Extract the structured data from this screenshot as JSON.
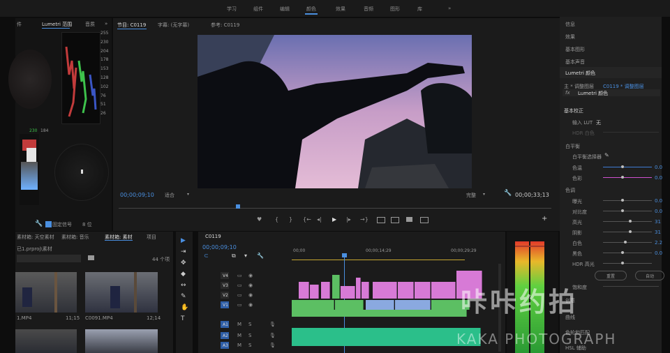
{
  "menu": [
    "学习",
    "组件",
    "编辑",
    "颜色",
    "效果",
    "音频",
    "图形",
    "库",
    "»"
  ],
  "scope": {
    "tab_prev": "件",
    "tab_active": "Lumetri 范围",
    "tab_next": "音质",
    "more": "»",
    "waveform_scale": [
      "255",
      "230",
      "204",
      "178",
      "153",
      "128",
      "102",
      "76",
      "51",
      "26"
    ],
    "hist_scale": [
      "230",
      "184"
    ],
    "bit_depth_label": "固定信号",
    "bit_value": "8 位"
  },
  "program": {
    "tab_program": "节目: C0119",
    "tab_caption": "字幕: (无字幕)",
    "tab_ref": "参考: C0119",
    "timecode": "00;00;09;10",
    "fit": "适合",
    "quality": "完整",
    "duration": "00;00;33;13",
    "transport_left": [
      "♥",
      "{",
      "}"
    ],
    "transport_main": [
      "{←",
      "◂|",
      "▶",
      "|▸",
      "→}"
    ]
  },
  "right": {
    "items": [
      "信息",
      "效果",
      "基本图形",
      "基本声音"
    ],
    "lumetri_title": "Lumetri 颜色",
    "path_main": "主 * 调整图层",
    "path_clip": "C0119 * 调整图层",
    "fx": "fx",
    "effect_name": "Lumetri 颜色",
    "basic": "基本校正",
    "lut_label": "输入 LUT",
    "lut_value": "无",
    "hdr_label": "HDR 白色",
    "wb_group": "白平衡",
    "wb_picker": "白平衡选择器",
    "wb_sliders": [
      {
        "label": "色温",
        "value": "0.0",
        "pos": 0.4,
        "color": "#3f7dd6"
      },
      {
        "label": "色彩",
        "value": "0.0",
        "pos": 0.4,
        "color": "#d050d0"
      }
    ],
    "tone_group": "色调",
    "tone_sliders": [
      {
        "label": "曝光",
        "value": "0.0",
        "pos": 0.4
      },
      {
        "label": "对比度",
        "value": "0.0",
        "pos": 0.4
      },
      {
        "label": "高光",
        "value": "31",
        "pos": 0.55
      },
      {
        "label": "阴影",
        "value": "31",
        "pos": 0.55
      },
      {
        "label": "白色",
        "value": "2.2",
        "pos": 0.45
      },
      {
        "label": "黑色",
        "value": "0.0",
        "pos": 0.4
      },
      {
        "label": "HDR 高光",
        "value": "",
        "pos": 0.4
      }
    ],
    "reset_btn": "重置",
    "auto_btn": "自动",
    "saturation_label": "饱和度",
    "bottom_items": [
      "创意",
      "曲线",
      "色轮和匹配",
      "HSL 辅助"
    ]
  },
  "project": {
    "tabs": [
      "素材箱: 天空素材",
      "素材箱: 音乐",
      "素材箱: 素材",
      "项目"
    ],
    "bin_path": "已1.prproj\\素材",
    "count": "44 个项",
    "thumbs": [
      {
        "name": "",
        "dur": ""
      },
      {
        "name": "",
        "dur": ""
      },
      {
        "name": "",
        "dur": ""
      },
      {
        "name": "",
        "dur": ""
      }
    ],
    "thumb_labels": [
      {
        "name": "1.MP4",
        "dur": "11;15"
      },
      {
        "name": "C0091.MP4",
        "dur": "12;14"
      }
    ]
  },
  "tools": [
    "▶",
    "⇥",
    "✥",
    "◆",
    "↔",
    "✎",
    "✋",
    "T"
  ],
  "timeline": {
    "tab": "C0119",
    "timecode": "00;00;09;10",
    "ruler": [
      "00;00",
      "00;00;14;29",
      "00;00;29;29"
    ],
    "tracks": [
      {
        "name": "V4"
      },
      {
        "name": "V3"
      },
      {
        "name": "V2"
      },
      {
        "name": "V1"
      },
      {
        "name": "A1"
      },
      {
        "name": "A2"
      },
      {
        "name": "A3"
      }
    ],
    "track_prefix": "V1",
    "audio_prefix": "A1"
  },
  "watermark": {
    "cn": "咔咔约拍",
    "en": "KAKA PHOTOGRAPH"
  },
  "colors": {
    "accent": "#4a8fe0",
    "clip_pink": "#d77ad6",
    "clip_green": "#5cbf63",
    "clip_blue": "#8aa9e0",
    "audio_green": "#2bbf8a"
  }
}
